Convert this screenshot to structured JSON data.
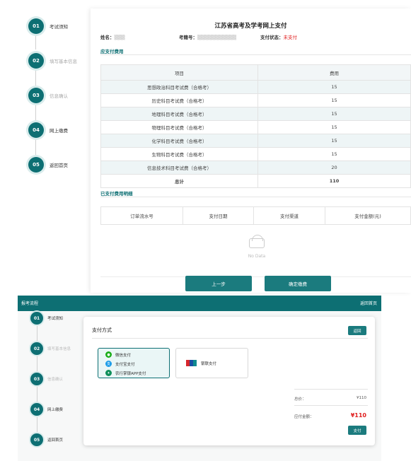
{
  "top": {
    "steps": [
      {
        "num": "01",
        "label": "考试须知"
      },
      {
        "num": "02",
        "label": "填写基本信息"
      },
      {
        "num": "03",
        "label": "信息确认"
      },
      {
        "num": "04",
        "label": "网上缴费"
      },
      {
        "num": "05",
        "label": "返回首页"
      }
    ],
    "title": "江苏省高考及学考网上支付",
    "info": {
      "name_label": "姓名：",
      "exam_no_label": "考籍号：",
      "status_label": "支付状态：",
      "status_value": "未支付"
    },
    "fee_section_title": "应支付费用",
    "fee_table": {
      "headers": [
        "项目",
        "费用"
      ],
      "rows": [
        {
          "item": "思想政治科目考试费（合格考）",
          "fee": "15"
        },
        {
          "item": "历史科目考试费（合格考）",
          "fee": "15"
        },
        {
          "item": "地理科目考试费（合格考）",
          "fee": "15"
        },
        {
          "item": "物理科目考试费（合格考）",
          "fee": "15"
        },
        {
          "item": "化学科目考试费（合格考）",
          "fee": "15"
        },
        {
          "item": "生物科目考试费（合格考）",
          "fee": "15"
        },
        {
          "item": "信息技术科目考试费（合格考）",
          "fee": "20"
        }
      ],
      "total_label": "总计",
      "total_value": "110"
    },
    "paid_section_title": "已支付费用明细",
    "paid_table_headers": [
      "订单流水号",
      "支付日期",
      "支付渠道",
      "支付金额(元)"
    ],
    "no_data": "No Data",
    "prev_button": "上一步",
    "confirm_button": "确定缴费"
  },
  "bottom": {
    "header_title": "报考流程",
    "header_home": "返回首页",
    "steps": [
      {
        "num": "01",
        "label": "考试须知"
      },
      {
        "num": "02",
        "label": "填写基本信息"
      },
      {
        "num": "03",
        "label": "信息确认"
      },
      {
        "num": "04",
        "label": "网上缴费"
      },
      {
        "num": "05",
        "label": "返回首页"
      }
    ],
    "pay_title": "支付方式",
    "back_button": "返回",
    "options": {
      "wechat": "微信支付",
      "alipay": "支付宝支付",
      "abc": "农行掌银APP支付",
      "unionpay": "银联支付"
    },
    "total_label": "总价：",
    "total_value": "¥110",
    "pay_amount_label": "应付金额：",
    "pay_amount_value": "¥110",
    "pay_button": "支付"
  },
  "colors": {
    "accent": "#0d6f73",
    "button": "#1b7b7e",
    "status_red": "#e02020"
  }
}
